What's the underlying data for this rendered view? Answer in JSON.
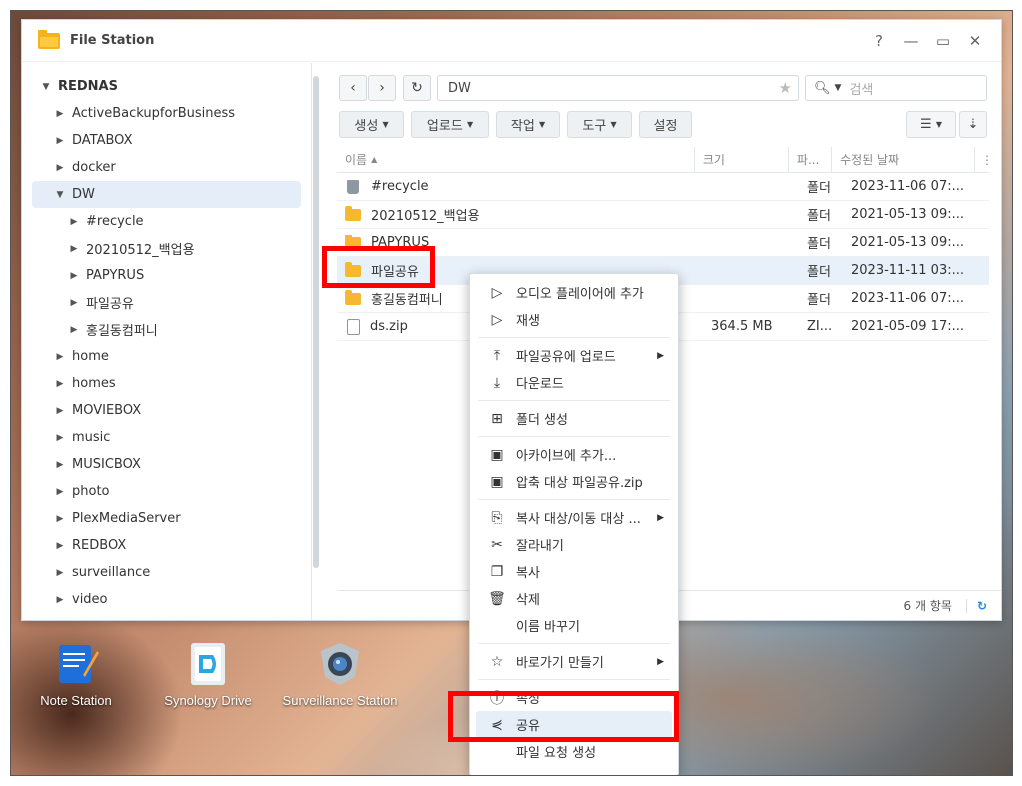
{
  "window": {
    "title": "File Station",
    "controls": [
      "?",
      "—",
      "▭",
      "✕"
    ]
  },
  "sidebar": {
    "root": "REDNAS",
    "items": [
      {
        "label": "ActiveBackupforBusiness",
        "level": 1,
        "expanded": false
      },
      {
        "label": "DATABOX",
        "level": 1,
        "expanded": false
      },
      {
        "label": "docker",
        "level": 1,
        "expanded": false
      },
      {
        "label": "DW",
        "level": 1,
        "expanded": true,
        "selected": true
      },
      {
        "label": "#recycle",
        "level": 2,
        "expanded": false
      },
      {
        "label": "20210512_백업용",
        "level": 2,
        "expanded": false
      },
      {
        "label": "PAPYRUS",
        "level": 2,
        "expanded": false
      },
      {
        "label": "파일공유",
        "level": 2,
        "expanded": false
      },
      {
        "label": "홍길동컴퍼니",
        "level": 2,
        "expanded": false
      },
      {
        "label": "home",
        "level": 1,
        "expanded": false
      },
      {
        "label": "homes",
        "level": 1,
        "expanded": false
      },
      {
        "label": "MOVIEBOX",
        "level": 1,
        "expanded": false
      },
      {
        "label": "music",
        "level": 1,
        "expanded": false
      },
      {
        "label": "MUSICBOX",
        "level": 1,
        "expanded": false
      },
      {
        "label": "photo",
        "level": 1,
        "expanded": false
      },
      {
        "label": "PlexMediaServer",
        "level": 1,
        "expanded": false
      },
      {
        "label": "REDBOX",
        "level": 1,
        "expanded": false
      },
      {
        "label": "surveillance",
        "level": 1,
        "expanded": false
      },
      {
        "label": "video",
        "level": 1,
        "expanded": false
      }
    ]
  },
  "nav": {
    "path": "DW",
    "search_placeholder": "검색"
  },
  "toolbar": {
    "create": "생성",
    "upload": "업로드",
    "action": "작업",
    "tools": "도구",
    "settings": "설정"
  },
  "grid": {
    "headers": {
      "name": "이름",
      "size": "크기",
      "type": "파...",
      "modified": "수정된 날짜"
    },
    "rows": [
      {
        "name": "#recycle",
        "icon": "trash-icon",
        "size": "",
        "type": "폴더",
        "modified": "2023-11-06 07:..."
      },
      {
        "name": "20210512_백업용",
        "icon": "folder-icon",
        "size": "",
        "type": "폴더",
        "modified": "2021-05-13 09:..."
      },
      {
        "name": "PAPYRUS",
        "icon": "folder-icon",
        "size": "",
        "type": "폴더",
        "modified": "2021-05-13 09:..."
      },
      {
        "name": "파일공유",
        "icon": "folder-icon",
        "size": "",
        "type": "폴더",
        "modified": "2023-11-11 03:...",
        "selected": true
      },
      {
        "name": "홍길동컴퍼니",
        "icon": "folder-icon",
        "size": "",
        "type": "폴더",
        "modified": "2023-11-06 07:..."
      },
      {
        "name": "ds.zip",
        "icon": "zip-file-icon",
        "size": "364.5 MB",
        "type": "ZI...",
        "modified": "2021-05-09 17:..."
      }
    ]
  },
  "status": {
    "count": "6 개 항목"
  },
  "context_menu": {
    "items": [
      {
        "label": "오디오 플레이어에 추가",
        "icon": "play-icon"
      },
      {
        "label": "재생",
        "icon": "play-icon"
      },
      {
        "sep": true
      },
      {
        "label": "파일공유에 업로드",
        "icon": "upload-icon",
        "submenu": true
      },
      {
        "label": "다운로드",
        "icon": "download-icon"
      },
      {
        "sep": true
      },
      {
        "label": "폴더 생성",
        "icon": "new-folder-icon"
      },
      {
        "sep": true
      },
      {
        "label": "아카이브에 추가...",
        "icon": "archive-icon"
      },
      {
        "label": "압축 대상 파일공유.zip",
        "icon": "archive-icon"
      },
      {
        "sep": true
      },
      {
        "label": "복사 대상/이동 대상 ...",
        "icon": "copy-to-icon",
        "submenu": true
      },
      {
        "label": "잘라내기",
        "icon": "scissors-icon"
      },
      {
        "label": "복사",
        "icon": "copy-icon"
      },
      {
        "label": "삭제",
        "icon": "trash-icon"
      },
      {
        "label": "이름 바꾸기",
        "icon": ""
      },
      {
        "sep": true
      },
      {
        "label": "바로가기 만들기",
        "icon": "star-icon",
        "submenu": true
      },
      {
        "sep": true
      },
      {
        "label": "속성",
        "icon": "info-icon"
      },
      {
        "label": "공유",
        "icon": "share-icon",
        "highlighted": true
      },
      {
        "label": "파일 요청 생성",
        "icon": ""
      }
    ]
  },
  "desktop": {
    "icons": [
      {
        "label": "Note Station",
        "icon": "note-station-icon"
      },
      {
        "label": "Synology Drive",
        "icon": "synology-drive-icon"
      },
      {
        "label": "Surveillance Station",
        "icon": "surveillance-station-icon"
      }
    ]
  }
}
